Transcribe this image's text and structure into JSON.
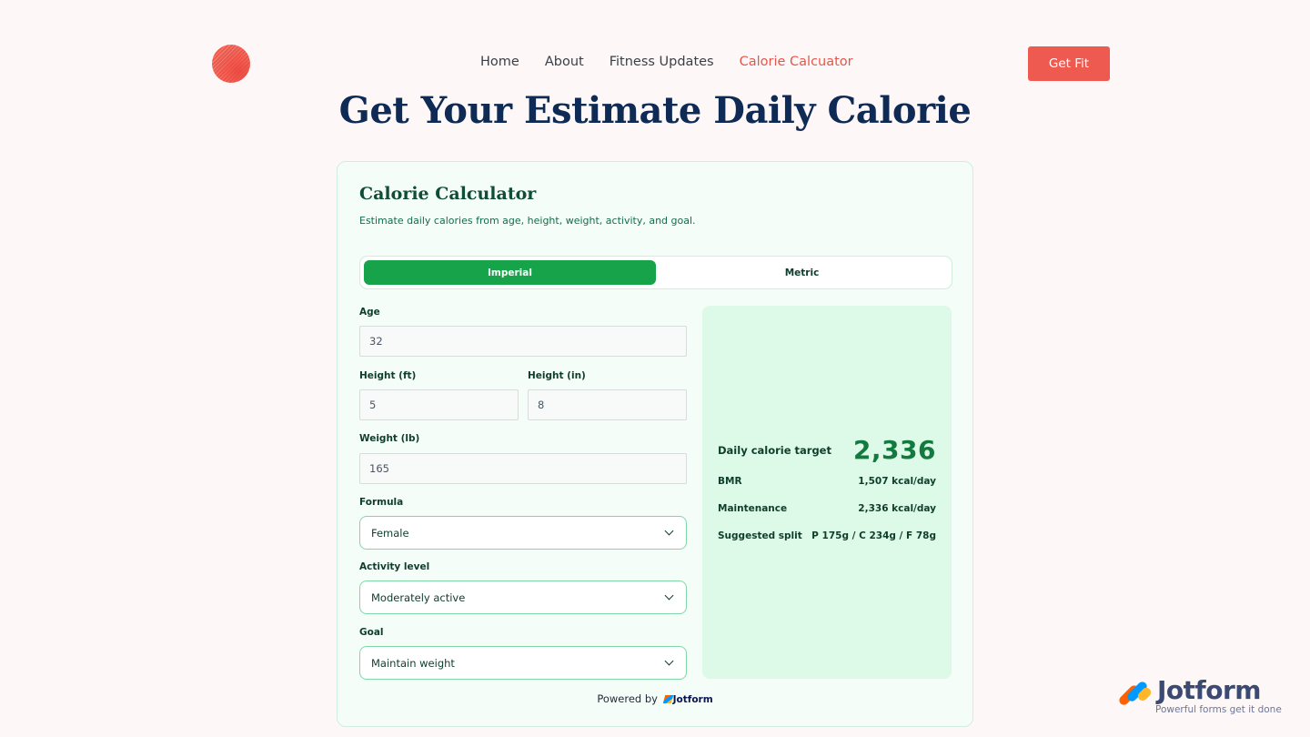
{
  "nav": {
    "items": [
      "Home",
      "About",
      "Fitness Updates",
      "Calorie Calcuator"
    ],
    "active_index": 3,
    "cta_label": "Get Fit"
  },
  "hero": {
    "title": "Get Your Estimate Daily Calorie"
  },
  "calculator": {
    "title": "Calorie Calculator",
    "subtitle": "Estimate daily calories from age, height, weight, activity, and goal.",
    "unit_toggle": {
      "options": [
        "Imperial",
        "Metric"
      ],
      "selected": "Imperial"
    },
    "fields": {
      "age": {
        "label": "Age",
        "value": "32"
      },
      "height_ft": {
        "label": "Height (ft)",
        "value": "5"
      },
      "height_in": {
        "label": "Height (in)",
        "value": "8"
      },
      "weight": {
        "label": "Weight (lb)",
        "value": "165"
      },
      "formula": {
        "label": "Formula",
        "value": "Female"
      },
      "activity": {
        "label": "Activity level",
        "value": "Moderately active"
      },
      "goal": {
        "label": "Goal",
        "value": "Maintain weight"
      }
    },
    "results": {
      "target_label": "Daily calorie target",
      "target_value": "2,336",
      "rows": [
        {
          "label": "BMR",
          "value": "1,507 kcal/day"
        },
        {
          "label": "Maintenance",
          "value": "2,336 kcal/day"
        },
        {
          "label": "Suggested split",
          "value": "P 175g / C 234g / F 78g"
        }
      ]
    },
    "footer": {
      "prefix": "Powered by",
      "brand": "Jotform"
    }
  },
  "badge": {
    "name": "Jotform",
    "tagline": "Powerful forms get it done"
  },
  "colors": {
    "accent": "#ee5a4f",
    "primary_green": "#17a34a",
    "heading_navy": "#0e2a55"
  },
  "icons": [
    "site-logo-icon",
    "chevron-down-icon",
    "jotform-logo-icon"
  ]
}
